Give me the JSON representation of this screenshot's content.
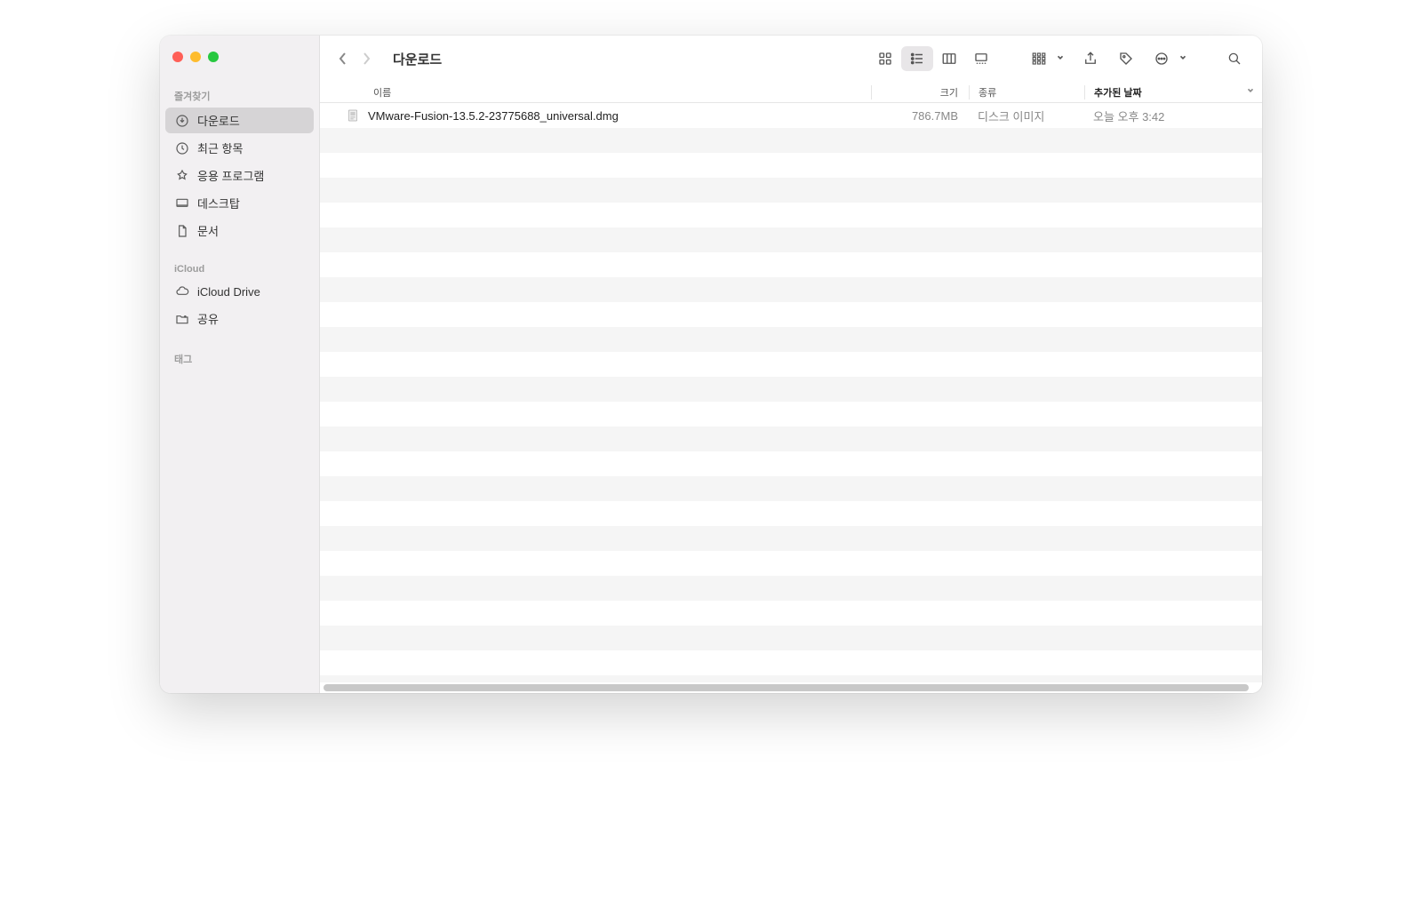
{
  "window": {
    "title": "다운로드"
  },
  "sidebar": {
    "sections": [
      {
        "header": "즐겨찾기",
        "items": [
          {
            "label": "다운로드",
            "icon": "download",
            "selected": true
          },
          {
            "label": "최근 항목",
            "icon": "clock",
            "selected": false
          },
          {
            "label": "응용 프로그램",
            "icon": "apps",
            "selected": false
          },
          {
            "label": "데스크탑",
            "icon": "desktop",
            "selected": false
          },
          {
            "label": "문서",
            "icon": "document",
            "selected": false
          }
        ]
      },
      {
        "header": "iCloud",
        "items": [
          {
            "label": "iCloud Drive",
            "icon": "cloud",
            "selected": false
          },
          {
            "label": "공유",
            "icon": "shared-folder",
            "selected": false
          }
        ]
      },
      {
        "header": "태그",
        "items": []
      }
    ]
  },
  "columns": {
    "name": "이름",
    "size": "크기",
    "kind": "종류",
    "date": "추가된 날짜"
  },
  "files": [
    {
      "name": "VMware-Fusion-13.5.2-23775688_universal.dmg",
      "size": "786.7MB",
      "kind": "디스크 이미지",
      "date": "오늘 오후 3:42"
    }
  ]
}
